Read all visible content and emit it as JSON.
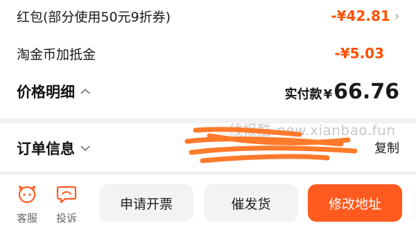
{
  "price_section": {
    "red_packet": {
      "label": "红包(部分使用50元9折券)",
      "amount": "-¥42.81"
    },
    "taojinbi": {
      "label": "淘金币加抵金",
      "amount": "-¥5.03"
    },
    "detail_label": "价格明细",
    "pay_label": "实付款",
    "pay_currency": "¥",
    "pay_amount": "66.76"
  },
  "order_section": {
    "title": "订单信息",
    "copy_label": "复制"
  },
  "watermark": "线报酷-new.xianbao.fun",
  "bottom_bar": {
    "service_label": "客服",
    "complaint_label": "投诉",
    "invoice_button": "申请开票",
    "urge_button": "催发货",
    "address_button": "修改地址"
  },
  "colors": {
    "accent": "#ff5000",
    "orange_button": "#ff5a1f",
    "button_gray": "#f3f3f3"
  }
}
